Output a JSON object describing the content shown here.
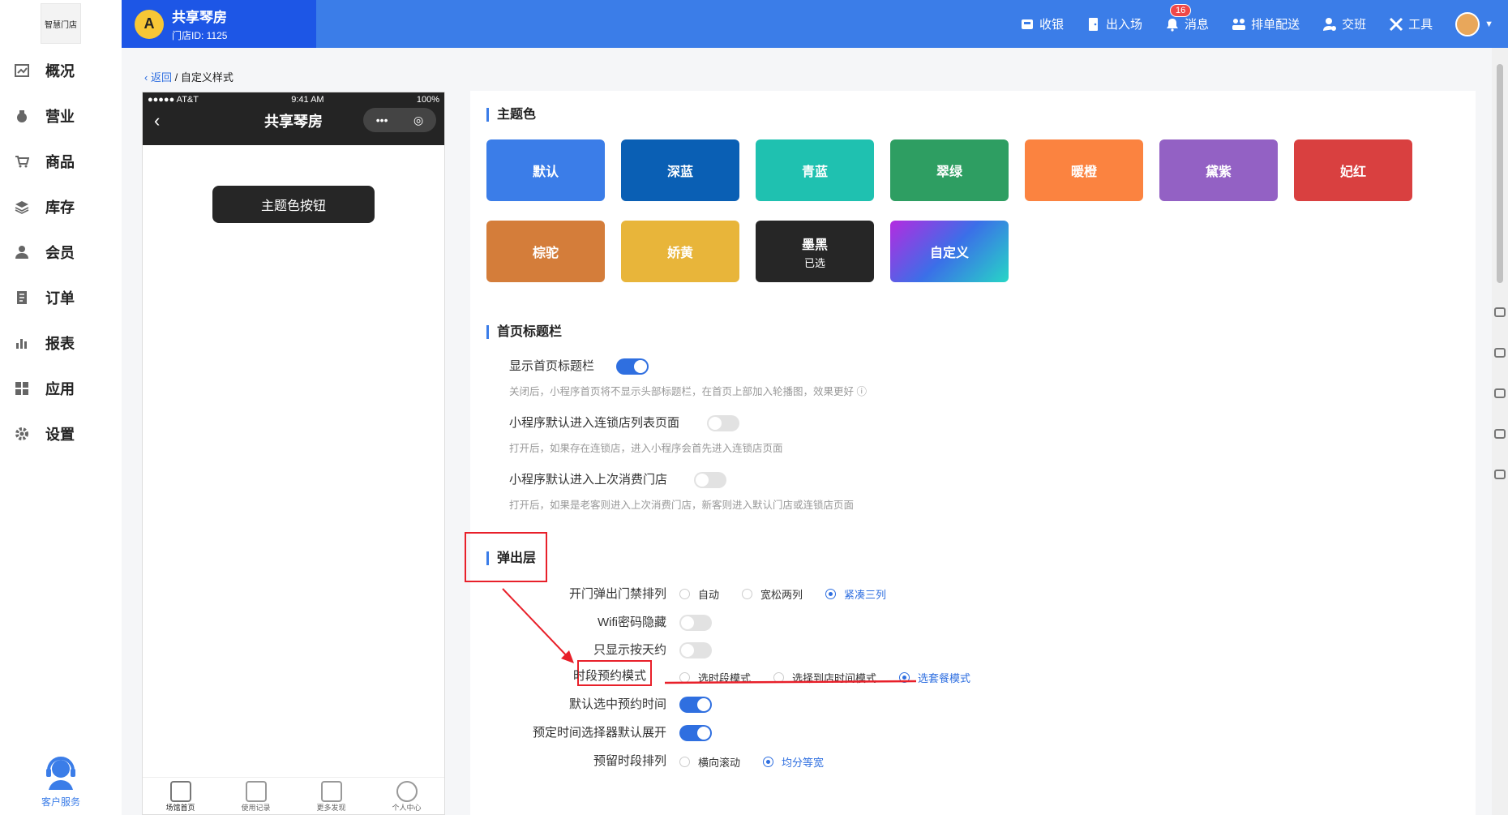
{
  "header": {
    "logo_text": "智慧门店",
    "store": {
      "avatar": "A",
      "name": "共享琴房",
      "id": "门店ID: 1125"
    },
    "nav": [
      {
        "label": "收银",
        "icon": "cashier-icon"
      },
      {
        "label": "出入场",
        "icon": "door-icon"
      },
      {
        "label": "消息",
        "icon": "bell-icon",
        "badge": "16"
      },
      {
        "label": "排单配送",
        "icon": "delivery-icon"
      },
      {
        "label": "交班",
        "icon": "shift-icon"
      },
      {
        "label": "工具",
        "icon": "tools-icon"
      }
    ]
  },
  "sidebar": {
    "items": [
      {
        "label": "概况",
        "icon": "chart-icon"
      },
      {
        "label": "营业",
        "icon": "money-bag-icon"
      },
      {
        "label": "商品",
        "icon": "cart-icon"
      },
      {
        "label": "库存",
        "icon": "layers-icon"
      },
      {
        "label": "会员",
        "icon": "user-icon"
      },
      {
        "label": "订单",
        "icon": "order-icon"
      },
      {
        "label": "报表",
        "icon": "bar-chart-icon"
      },
      {
        "label": "应用",
        "icon": "apps-icon"
      },
      {
        "label": "设置",
        "icon": "gear-icon"
      }
    ],
    "service": "客户服务"
  },
  "breadcrumb": {
    "back": "返回",
    "sep": "/",
    "current": "自定义样式"
  },
  "phone": {
    "carrier": "●●●●● AT&T",
    "time": "9:41 AM",
    "battery": "100%",
    "title": "共享琴房",
    "capsule_more": "•••",
    "capsule_close": "◎",
    "theme_button": "主题色按钮",
    "tabs": [
      {
        "label": "场馆首页"
      },
      {
        "label": "使用记录"
      },
      {
        "label": "更多发现"
      },
      {
        "label": "个人中心"
      }
    ]
  },
  "theme": {
    "title": "主题色",
    "swatches": [
      {
        "label": "默认",
        "color": "#3b7de8"
      },
      {
        "label": "深蓝",
        "color": "#0a5fb4"
      },
      {
        "label": "青蓝",
        "color": "#1fc1b0"
      },
      {
        "label": "翠绿",
        "color": "#2e9e62"
      },
      {
        "label": "暖橙",
        "color": "#fb8340"
      },
      {
        "label": "黛紫",
        "color": "#9361c4"
      },
      {
        "label": "妃红",
        "color": "#d94040"
      },
      {
        "label": "棕驼",
        "color": "#d47d3a"
      },
      {
        "label": "娇黄",
        "color": "#e8b53a"
      },
      {
        "label": "墨黑",
        "color": "#262626",
        "selected": "已选"
      },
      {
        "label": "自定义",
        "color": "gradient"
      }
    ]
  },
  "homebar": {
    "title": "首页标题栏",
    "rows": [
      {
        "label": "显示首页标题栏",
        "on": true,
        "hint": "关闭后，小程序首页将不显示头部标题栏，在首页上部加入轮播图，效果更好"
      },
      {
        "label": "小程序默认进入连锁店列表页面",
        "on": false,
        "hint": "打开后，如果存在连锁店，进入小程序会首先进入连锁店页面"
      },
      {
        "label": "小程序默认进入上次消费门店",
        "on": false,
        "hint": "打开后，如果是老客则进入上次消费门店，新客则进入默认门店或连锁店页面"
      }
    ]
  },
  "popup": {
    "title": "弹出层",
    "rows": [
      {
        "label": "开门弹出门禁排列",
        "type": "radio",
        "options": [
          "自动",
          "宽松两列",
          "紧凑三列"
        ],
        "selected": 2
      },
      {
        "label": "Wifi密码隐藏",
        "type": "toggle",
        "on": false
      },
      {
        "label": "只显示按天约",
        "type": "toggle",
        "on": false
      },
      {
        "label": "时段预约模式",
        "type": "radio",
        "options": [
          "选时段模式",
          "选择到店时间模式",
          "选套餐模式"
        ],
        "selected": 2
      },
      {
        "label": "默认选中预约时间",
        "type": "toggle",
        "on": true
      },
      {
        "label": "预定时间选择器默认展开",
        "type": "toggle",
        "on": true
      },
      {
        "label": "预留时段排列",
        "type": "radio",
        "options": [
          "横向滚动",
          "均分等宽"
        ],
        "selected": 1
      }
    ]
  },
  "colors": {
    "accent": "#3b7de8",
    "annotation": "#e8202a"
  }
}
